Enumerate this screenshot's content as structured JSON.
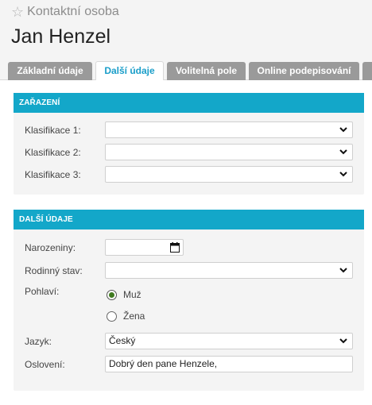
{
  "header": {
    "subtitle": "Kontaktní osoba",
    "title": "Jan Henzel",
    "star_icon": "star-outline-icon"
  },
  "tabs": [
    {
      "label": "Základní údaje",
      "active": false
    },
    {
      "label": "Další údaje",
      "active": true
    },
    {
      "label": "Volitelná pole",
      "active": false
    },
    {
      "label": "Online podepisování",
      "active": false
    },
    {
      "label": "",
      "active": false
    }
  ],
  "classification": {
    "heading": "ZAŘAZENÍ",
    "fields": [
      {
        "label": "Klasifikace 1:",
        "value": ""
      },
      {
        "label": "Klasifikace 2:",
        "value": ""
      },
      {
        "label": "Klasifikace 3:",
        "value": ""
      }
    ]
  },
  "details": {
    "heading": "DALŠÍ ÚDAJE",
    "birthday": {
      "label": "Narozeniny:",
      "value": ""
    },
    "marital": {
      "label": "Rodinný stav:",
      "value": ""
    },
    "gender": {
      "label": "Pohlaví:",
      "options": [
        {
          "label": "Muž",
          "checked": true
        },
        {
          "label": "Žena",
          "checked": false
        }
      ]
    },
    "language": {
      "label": "Jazyk:",
      "value": "Český"
    },
    "salutation": {
      "label": "Oslovení:",
      "value": "Dobrý den pane Henzele,"
    }
  },
  "colors": {
    "accent": "#13a7c9",
    "tab_inactive": "#9a9a9a",
    "radio_checked": "#3f7a1f"
  }
}
